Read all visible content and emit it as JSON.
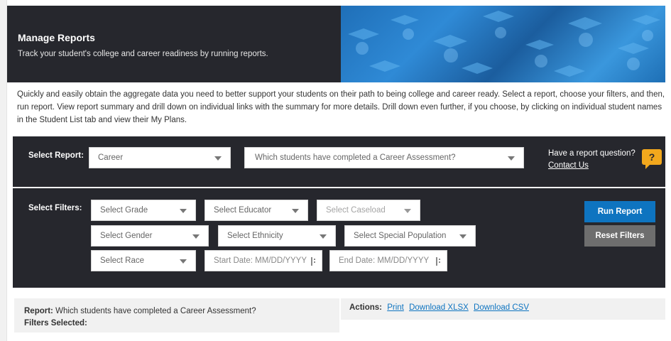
{
  "header": {
    "title": "Manage Reports",
    "subtitle": "Track your student's college and career readiness by running reports."
  },
  "intro": "Quickly and easily obtain the aggregate data you need to better support your students on their path to being college and career ready. Select a report, choose your filters, and then, run report. View report summary and drill down on individual links with the summary for more details. Drill down even further, if you choose, by clicking on individual student names in the Student List tab and view their My Plans.",
  "report_selector": {
    "label": "Select Report:",
    "category_value": "Career",
    "report_value": "Which students have completed a Career Assessment?",
    "question_text": "Have a report question?",
    "contact_link": "Contact Us",
    "help_icon": "question-chat-icon",
    "help_glyph": "?"
  },
  "filters": {
    "label": "Select Filters:",
    "grade": "Select Grade",
    "educator": "Select Educator",
    "caseload": "Select Caseload",
    "gender": "Select Gender",
    "ethnicity": "Select Ethnicity",
    "special_population": "Select Special Population",
    "race": "Select Race",
    "start_date": "Start Date: MM/DD/YYYY",
    "end_date": "End Date: MM/DD/YYYY",
    "calendar_icon": "calendar-icon"
  },
  "buttons": {
    "run": "Run Report",
    "reset": "Reset Filters"
  },
  "summary": {
    "report_label": "Report:",
    "report_value": "Which students have completed a Career Assessment?",
    "filters_label": "Filters Selected:",
    "actions_label": "Actions:",
    "print": "Print",
    "download_xlsx": "Download XLSX",
    "download_csv": "Download CSV"
  },
  "colors": {
    "dark_panel": "#26272d",
    "accent_blue": "#0e74c0",
    "reset_gray": "#6e6e6e",
    "help_yellow": "#f2a81d",
    "summary_bg": "#f1f1f1"
  }
}
